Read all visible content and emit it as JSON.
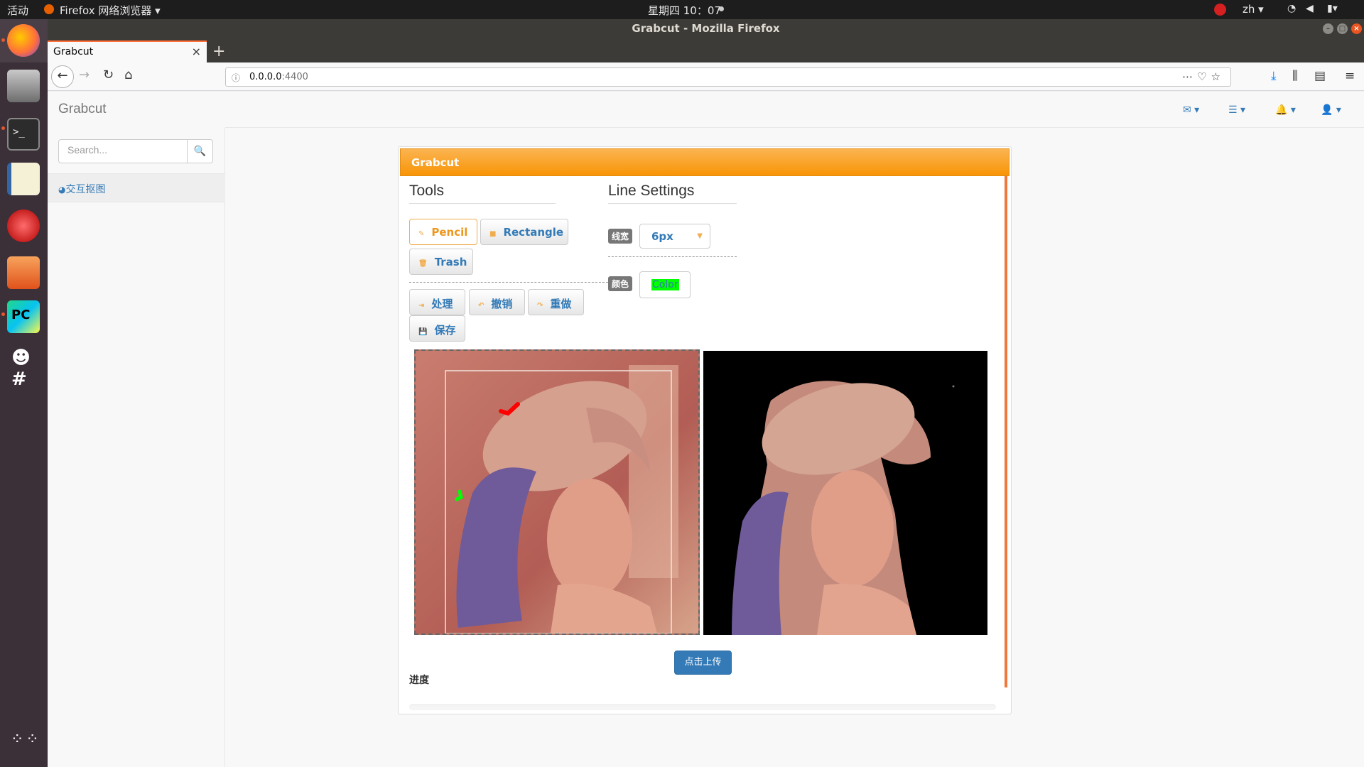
{
  "system_bar": {
    "activities": "活动",
    "app_menu": "Firefox 网络浏览器 ▾",
    "clock": "星期四 10：07",
    "language": "zh ▾"
  },
  "window": {
    "title": "Grabcut - Mozilla Firefox",
    "tab_title": "Grabcut",
    "url_host": "0.0.0.0",
    "url_port": ":4400"
  },
  "app": {
    "brand": "Grabcut",
    "search_placeholder": "Search...",
    "sidebar_item": "交互抠图",
    "panel_title": "Grabcut",
    "tools_heading": "Tools",
    "line_heading": "Line Settings",
    "tools": {
      "pencil": "Pencil",
      "rectangle": "Rectangle",
      "trash": "Trash",
      "process": "处理",
      "undo": "撤销",
      "redo": "重做",
      "save": "保存"
    },
    "line": {
      "width_label": "线宽",
      "width_value": "6px",
      "color_label": "颜色",
      "color_text": "Color",
      "color_value": "#00ff00"
    },
    "upload": "点击上传",
    "progress_label": "进度",
    "progress": 0
  },
  "colors": {
    "panel_header": "#f89406",
    "primary": "#337ab7",
    "warning": "#f0ad4e"
  }
}
